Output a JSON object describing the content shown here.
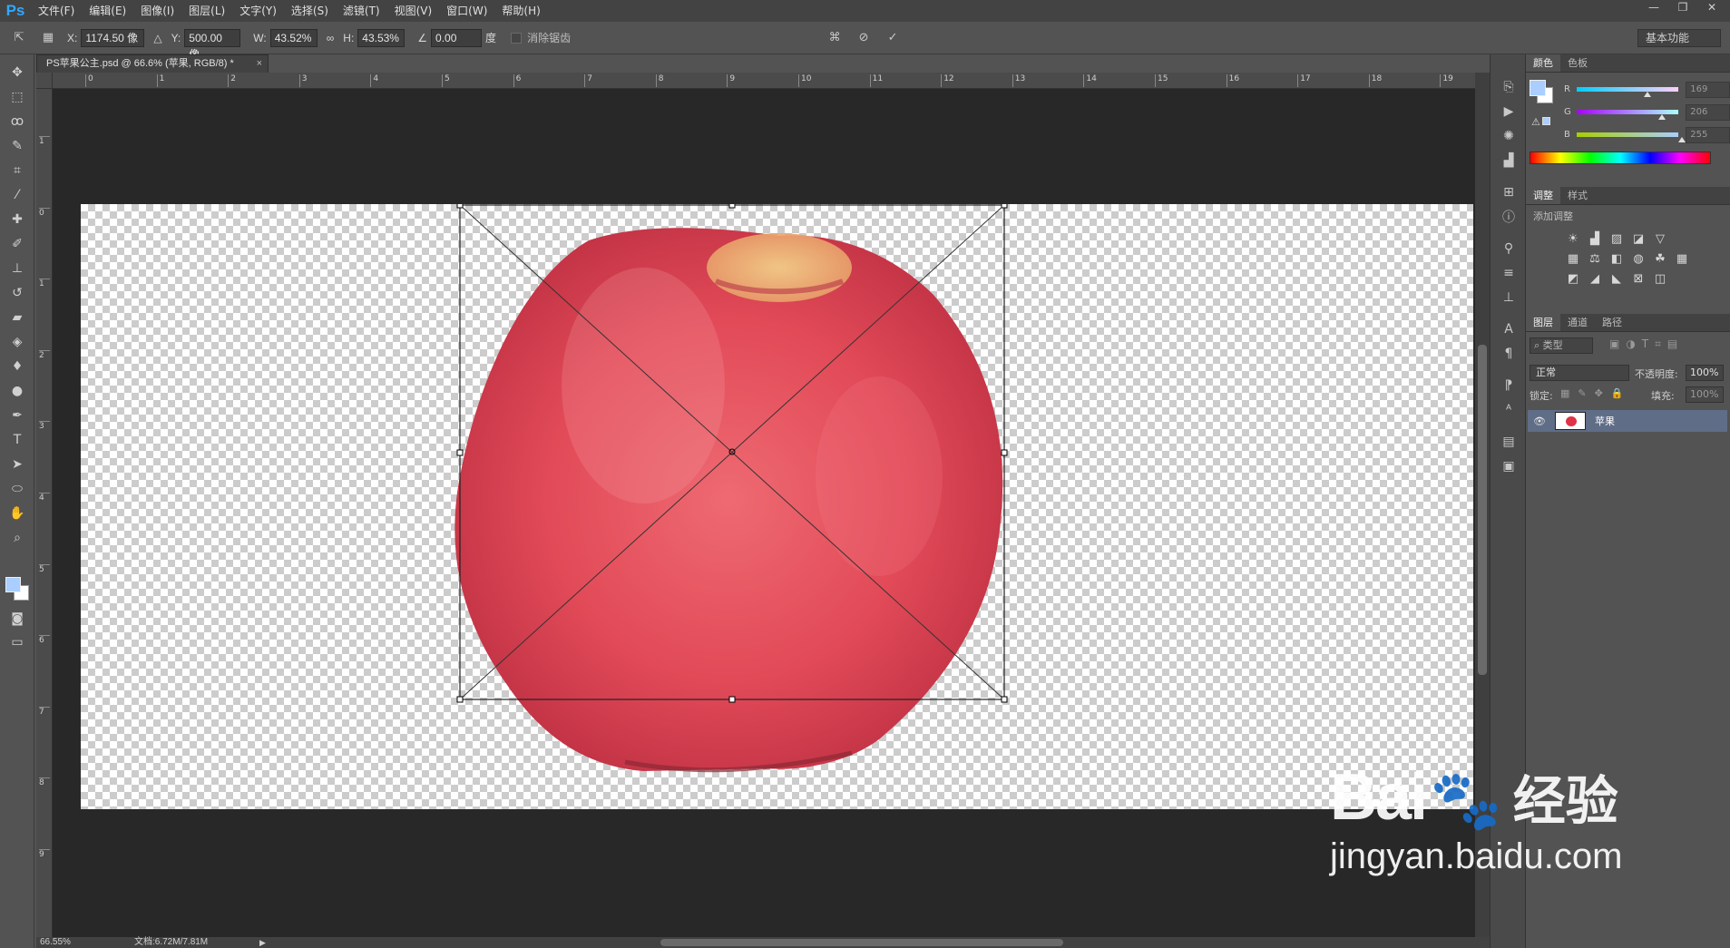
{
  "app": {
    "logo": "Ps",
    "menu": [
      "文件(F)",
      "编辑(E)",
      "图像(I)",
      "图层(L)",
      "文字(Y)",
      "选择(S)",
      "滤镜(T)",
      "视图(V)",
      "窗口(W)",
      "帮助(H)"
    ]
  },
  "options": {
    "x_label": "X:",
    "x_value": "1174.50 像",
    "y_label": "Y:",
    "y_value": "500.00 像",
    "w_label": "W:",
    "w_value": "43.52%",
    "h_label": "H:",
    "h_value": "43.53%",
    "angle_value": "0.00",
    "angle_unit": "度",
    "antialias_label": "消除锯齿",
    "workspace": "基本功能"
  },
  "document": {
    "tab_title": "PS苹果公主.psd @ 66.6% (苹果, RGB/8) *",
    "close": "×",
    "ruler_top": [
      "0",
      "1",
      "2",
      "3",
      "4",
      "5",
      "6",
      "7",
      "8",
      "9",
      "10",
      "11",
      "12",
      "13",
      "14",
      "15",
      "16",
      "17",
      "18",
      "19"
    ],
    "ruler_left": [
      "1",
      "0",
      "1",
      "2",
      "3",
      "4",
      "5",
      "6",
      "7",
      "8",
      "9"
    ],
    "zoom": "66.55%",
    "doc_size": "文档:6.72M/7.81M"
  },
  "color_panel": {
    "tabs": [
      "颜色",
      "色板"
    ],
    "r_label": "R",
    "r_value": "169",
    "r_fraction": 0.663,
    "g_label": "G",
    "g_value": "206",
    "g_fraction": 0.808,
    "b_label": "B",
    "b_value": "255",
    "b_fraction": 1.0,
    "fg_color": "#a9ceff"
  },
  "adjust_panel": {
    "tabs": [
      "调整",
      "样式"
    ],
    "add_label": "添加调整"
  },
  "layers_panel": {
    "tabs": [
      "图层",
      "通道",
      "路径"
    ],
    "filter_kind": "类型",
    "blend_mode": "正常",
    "opacity_label": "不透明度:",
    "opacity_value": "100%",
    "lock_label": "锁定:",
    "fill_label": "填充:",
    "fill_value": "100%",
    "layers": [
      {
        "name": "苹果"
      }
    ]
  },
  "watermark": {
    "brand": "Bai",
    "brand_suffix": "经验",
    "url": "jingyan.baidu.com"
  }
}
